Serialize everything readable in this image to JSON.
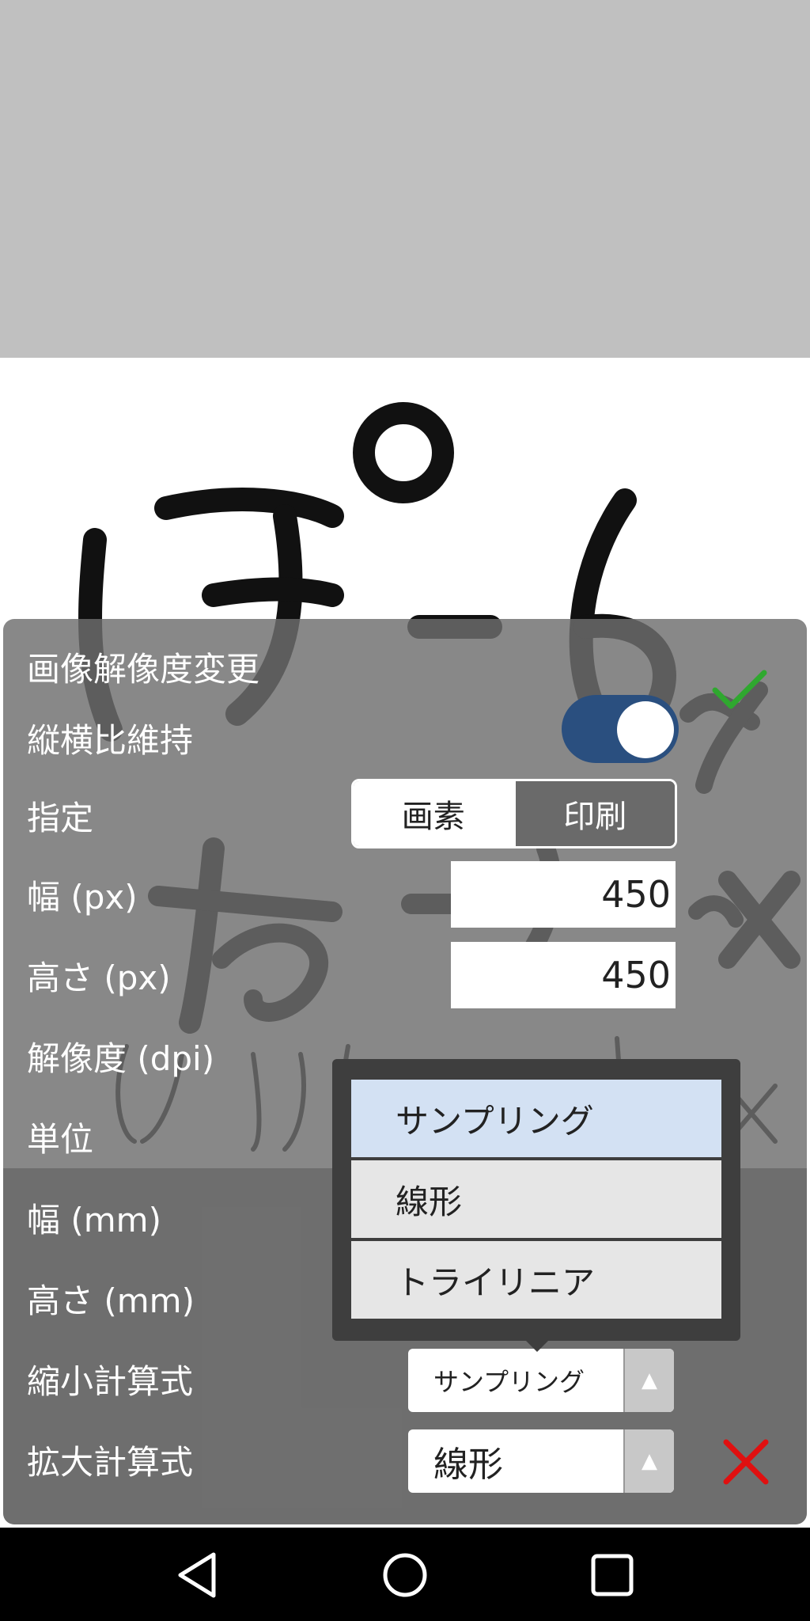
{
  "dialog": {
    "title": "画像解像度変更",
    "aspect_label": "縦横比維持",
    "aspect_enabled": true,
    "spec_label": "指定",
    "spec_options": [
      "画素",
      "印刷"
    ],
    "spec_selected": "画素",
    "width_px_label": "幅 (px)",
    "width_px_value": "450",
    "height_px_label": "高さ (px)",
    "height_px_value": "450",
    "dpi_label": "解像度 (dpi)",
    "unit_label": "単位",
    "width_mm_label": "幅 (mm)",
    "height_mm_label": "高さ (mm)",
    "shrink_label": "縮小計算式",
    "shrink_value": "サンプリング",
    "enlarge_label": "拡大計算式",
    "enlarge_value": "線形"
  },
  "dropdown": {
    "options": [
      "サンプリング",
      "線形",
      "トライリニア"
    ],
    "selected": "サンプリング"
  },
  "colors": {
    "confirm": "#2fa82f",
    "cancel": "#e01010",
    "toggle_track": "#2a4f7f",
    "selected_option": "#d3e1f3"
  },
  "icons": {
    "confirm": "checkmark-icon",
    "cancel": "close-icon",
    "back": "back-triangle-icon",
    "home": "home-circle-icon",
    "recents": "recents-square-icon"
  }
}
